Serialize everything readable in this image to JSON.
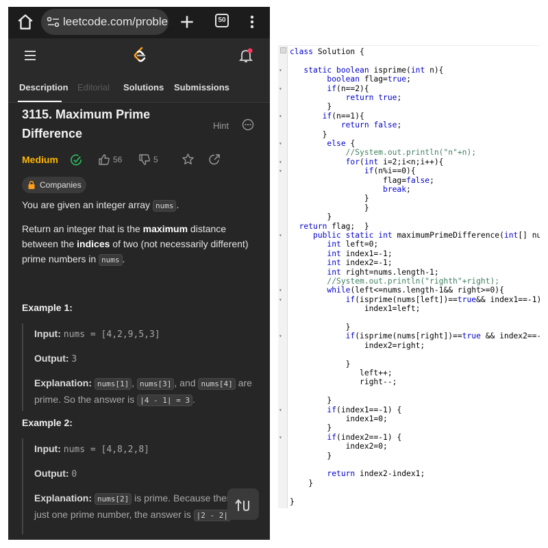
{
  "browser": {
    "url": "leetcode.com/proble",
    "tabs_count": "50"
  },
  "problem": {
    "tabs": [
      "Description",
      "Editorial",
      "Solutions",
      "Submissions"
    ],
    "title": "3115. Maximum Prime Difference",
    "hint_label": "Hint",
    "difficulty": "Medium",
    "likes": "56",
    "dislikes": "5",
    "companies_label": "Companies",
    "statement_prefix": "You are given an integer array ",
    "statement_code": "nums",
    "statement_suffix": ".",
    "task_1": "Return an integer that is the ",
    "task_bold_1": "maximum",
    "task_2": " distance between the ",
    "task_bold_2": "indices",
    "task_3": " of two (not necessarily different) prime numbers in ",
    "task_code": "nums",
    "task_4": ".",
    "example1": {
      "title": "Example 1:",
      "input_label": "Input:",
      "input_value": "nums = [4,2,9,5,3]",
      "output_label": "Output:",
      "output_value": "3",
      "explanation_label": "Explanation:",
      "code_a": "nums[1]",
      "sep_1": ", ",
      "code_b": "nums[3]",
      "sep_2": ", and ",
      "code_c": "nums[4]",
      "text_1": " are prime. So the answer is ",
      "code_d": "|4 - 1| = 3",
      "text_2": "."
    },
    "example2": {
      "title": "Example 2:",
      "input_label": "Input:",
      "input_value": "nums = [4,8,2,8]",
      "output_label": "Output:",
      "output_value": "0",
      "explanation_label": "Explanation:",
      "code_a": "nums[2]",
      "text_1": " is prime. Because there is just one prime number, the answer is ",
      "code_b": "|2 - 2|"
    }
  },
  "code": [
    "class Solution {",
    "",
    "   static boolean isprime(int n){",
    "        boolean flag=true;",
    "        if(n==2){",
    "            return true;",
    "        }",
    "       if(n==1){",
    "           return false;",
    "       }",
    "        else {",
    "            //System.out.println(\"n\"+n);",
    "            for(int i=2;i<n;i++){",
    "                if(n%i==0){",
    "                    flag=false;",
    "                    break;",
    "                }",
    "                }",
    "        }",
    "  return flag;  }",
    "     public static int maximumPrimeDifference(int[] nu",
    "        int left=0;",
    "        int index1=-1;",
    "        int index2=-1;",
    "        int right=nums.length-1;",
    "        //System.out.println(\"righth\"+right);",
    "        while(left<=nums.length-1&& right>=0){",
    "            if(isprime(nums[left])==true&& index1==-1)",
    "                index1=left;",
    "",
    "            }",
    "            if(isprime(nums[right])==true && index2==-",
    "                index2=right;",
    "",
    "            }",
    "               left++;",
    "               right--;",
    "",
    "        }",
    "        if(index1==-1) {",
    "            index1=0;",
    "        }",
    "        if(index2==-1) {",
    "            index2=0;",
    "        }",
    "",
    "        return index2-index1;",
    "    }",
    "",
    "}"
  ],
  "colors": {
    "difficulty_medium": "#ffb800",
    "solved_green": "#2cbb5d",
    "keyword_blue": "#0000cc",
    "comment_green": "#3f7f5f",
    "notification_red": "#ff375f"
  }
}
